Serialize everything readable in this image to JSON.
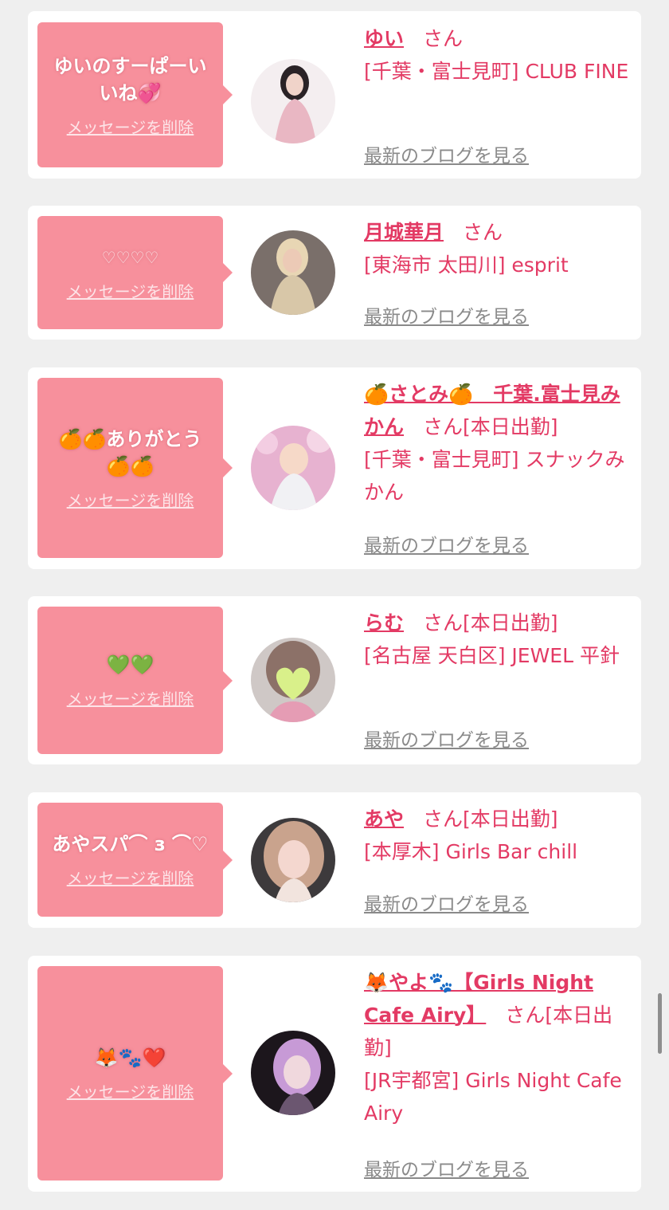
{
  "cards": [
    {
      "message": "ゆいのすーぱーいいね💞",
      "delete_label": "メッセージを削除",
      "name": "ゆい",
      "honorific": "さん",
      "status": "",
      "shop": "[千葉・富士見町] CLUB FINE",
      "blog_label": "最新のブログを見る"
    },
    {
      "message": "♡♡♡♡",
      "delete_label": "メッセージを削除",
      "name": "月城華月",
      "honorific": "さん",
      "status": "",
      "shop": "[東海市 太田川] esprit",
      "blog_label": "最新のブログを見る"
    },
    {
      "message": "🍊🍊ありがとう🍊🍊",
      "delete_label": "メッセージを削除",
      "name": "🍊さとみ🍊　千葉.富士見みかん",
      "honorific": "さん",
      "status": "[本日出勤]",
      "shop": "[千葉・富士見町] スナックみかん",
      "blog_label": "最新のブログを見る"
    },
    {
      "message": "💚💚",
      "delete_label": "メッセージを削除",
      "name": "らむ",
      "honorific": "さん",
      "status": "[本日出勤]",
      "shop": "[名古屋 天白区] JEWEL 平針",
      "blog_label": "最新のブログを見る"
    },
    {
      "message": "あやスパ⌒ з ⌒♡",
      "delete_label": "メッセージを削除",
      "name": "あや",
      "honorific": "さん",
      "status": "[本日出勤]",
      "shop": "[本厚木] Girls Bar chill",
      "blog_label": "最新のブログを見る"
    },
    {
      "message": "🦊🐾❤️",
      "delete_label": "メッセージを削除",
      "name": "🦊やよ🐾【Girls Night Cafe Airy】",
      "honorific": "さん",
      "status": "[本日出勤]",
      "shop": "[JR宇都宮] Girls Night Cafe Airy",
      "blog_label": "最新のブログを見る"
    }
  ]
}
